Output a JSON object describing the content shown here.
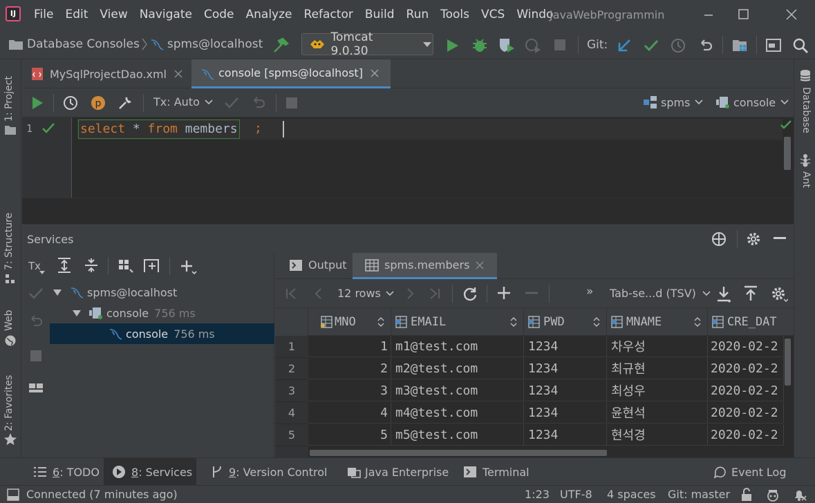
{
  "menu": [
    "File",
    "Edit",
    "View",
    "Navigate",
    "Code",
    "Analyze",
    "Refactor",
    "Build",
    "Run",
    "Tools",
    "VCS",
    "Windo"
  ],
  "window_title": "JavaWebProgrammin",
  "app_logo_text": "IJ",
  "breadcrumb": {
    "root": "Database Consoles",
    "item": "spms@localhost"
  },
  "run_config": "Tomcat 9.0.30",
  "git_label": "Git:",
  "editor_tabs": [
    {
      "label": "MySqlProjectDao.xml"
    },
    {
      "label": "console [spms@localhost]"
    }
  ],
  "console_toolbar": {
    "tx_mode": "Tx: Auto",
    "schema": "spms",
    "session": "console"
  },
  "editor": {
    "line_number": "1",
    "code_keyword_select": "select",
    "code_star": " * ",
    "code_keyword_from": "from",
    "code_table": " members",
    "code_semicolon": ";"
  },
  "left_strip": {
    "project": "1: Project",
    "structure": "7: Structure",
    "web": "Web",
    "favorites": "2: Favorites"
  },
  "right_strip": {
    "database": "Database",
    "ant": "Ant"
  },
  "services": {
    "title": "Services",
    "tx_label": "Tx",
    "tree": [
      {
        "label": "spms@localhost",
        "time": ""
      },
      {
        "label": "console",
        "time": "756 ms"
      },
      {
        "label": "console",
        "time": "756 ms"
      }
    ]
  },
  "result_tabs": [
    {
      "label": "Output"
    },
    {
      "label": "spms.members"
    }
  ],
  "result_toolbar": {
    "rows": "12 rows",
    "format": "Tab-se...d (TSV)",
    "more": "»"
  },
  "grid": {
    "columns": [
      "MNO",
      "EMAIL",
      "PWD",
      "MNAME",
      "CRE_DAT"
    ],
    "rows": [
      {
        "n": "1",
        "mno": "1",
        "email": "m1@test.com",
        "pwd": "1234",
        "mname": "차우성",
        "cre": "2020-02-2"
      },
      {
        "n": "2",
        "mno": "2",
        "email": "m2@test.com",
        "pwd": "1234",
        "mname": "최규현",
        "cre": "2020-02-2"
      },
      {
        "n": "3",
        "mno": "3",
        "email": "m3@test.com",
        "pwd": "1234",
        "mname": "최성우",
        "cre": "2020-02-2"
      },
      {
        "n": "4",
        "mno": "4",
        "email": "m4@test.com",
        "pwd": "1234",
        "mname": "윤현석",
        "cre": "2020-02-2"
      },
      {
        "n": "5",
        "mno": "5",
        "email": "m5@test.com",
        "pwd": "1234",
        "mname": "현석경",
        "cre": "2020-02-2"
      }
    ]
  },
  "tool_tabs": [
    {
      "num": "6",
      "label": ": TODO"
    },
    {
      "num": "8",
      "label": ": Services"
    },
    {
      "num": "9",
      "label": ": Version Control"
    },
    {
      "num": "",
      "label": "Java Enterprise"
    },
    {
      "num": "",
      "label": "Terminal"
    },
    {
      "num": "",
      "label": "Event Log"
    }
  ],
  "status": {
    "message": "Connected (7 minutes ago)",
    "position": "1:23",
    "encoding": "UTF-8",
    "indent": "4 spaces",
    "branch": "Git: master"
  },
  "colors": {
    "accent": "#4a88c7",
    "run_green": "#499c54",
    "keyword": "#cc7832",
    "selection": "#0d293e",
    "background": "#3c3f41",
    "editor_bg": "#2b2b2b"
  }
}
